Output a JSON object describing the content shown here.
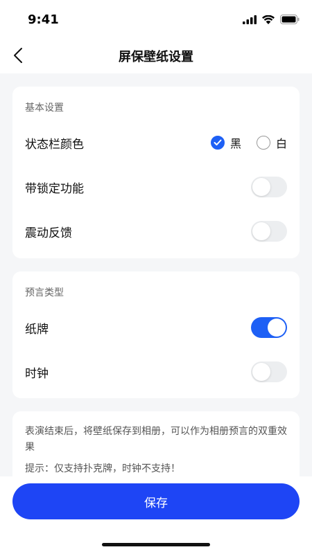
{
  "status_bar": {
    "time": "9:41"
  },
  "nav": {
    "title": "屏保壁纸设置"
  },
  "basic": {
    "section_label": "基本设置",
    "status_bar_color": {
      "label": "状态栏颜色",
      "options": [
        {
          "label": "黑",
          "checked": true
        },
        {
          "label": "白",
          "checked": false
        }
      ]
    },
    "lock": {
      "label": "带锁定功能",
      "on": false
    },
    "vibration": {
      "label": "震动反馈",
      "on": false
    }
  },
  "prophecy": {
    "section_label": "预言类型",
    "cards": {
      "label": "纸牌",
      "on": true
    },
    "clock": {
      "label": "时钟",
      "on": false
    }
  },
  "info": {
    "description": "表演结束后，将壁纸保存到相册，可以作为相册预言的双重效果",
    "tip": "提示：仅支持扑克牌，时钟不支持！"
  },
  "footer": {
    "save_label": "保存"
  },
  "colors": {
    "accent": "#1e60f5",
    "button": "#1e45f5"
  }
}
